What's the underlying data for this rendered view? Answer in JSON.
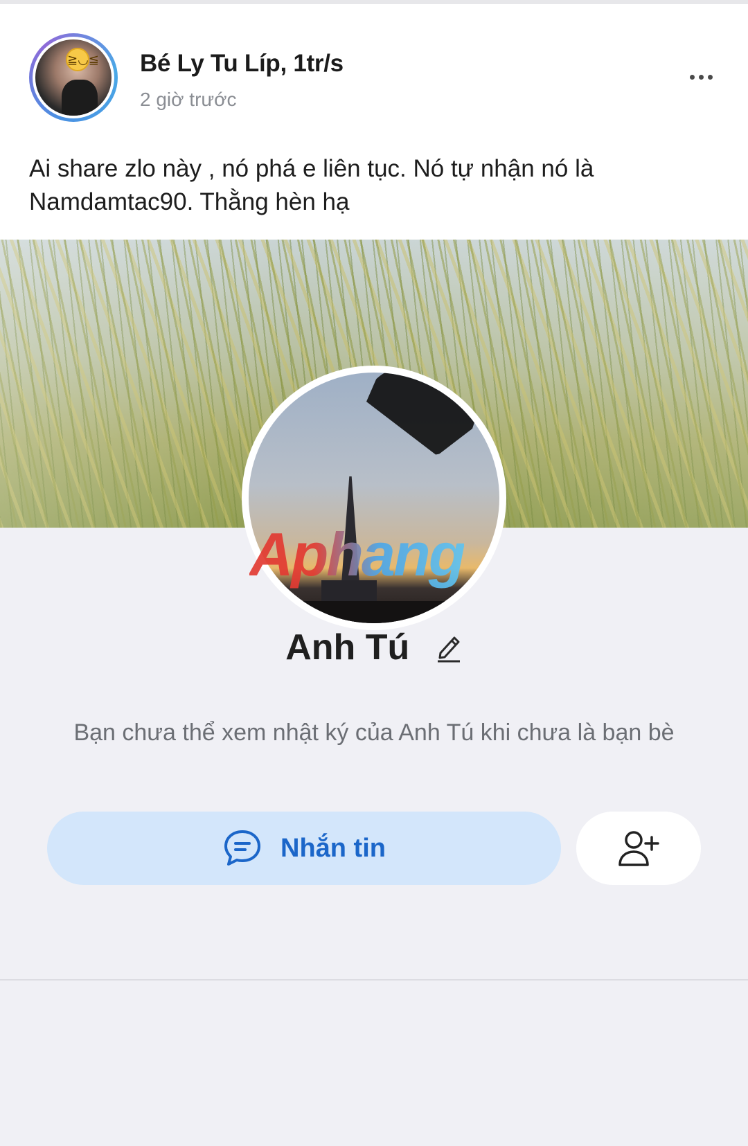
{
  "post": {
    "author_name": "Bé Ly Tu Líp, 1tr/s",
    "time": "2 giờ trước",
    "text": "Ai share zlo này , nó phá e liên tục. Nó tự nhận nó là Namdamtac90. Thằng hèn hạ",
    "more_icon": "more-dots-icon"
  },
  "profile": {
    "name": "Anh Tú",
    "notice": "Bạn chưa thể xem nhật ký của Anh Tú khi chưa là bạn bè",
    "message_label": "Nhắn tin",
    "message_icon": "chat-bubble-icon",
    "add_friend_icon": "add-friend-icon",
    "edit_icon": "pencil-icon"
  },
  "watermark": "Aphang",
  "colors": {
    "accent": "#1b66c9",
    "message_button_bg": "#d3e6fb",
    "muted_text": "#6b6e74",
    "avatar_ring": "#4a90e2"
  }
}
